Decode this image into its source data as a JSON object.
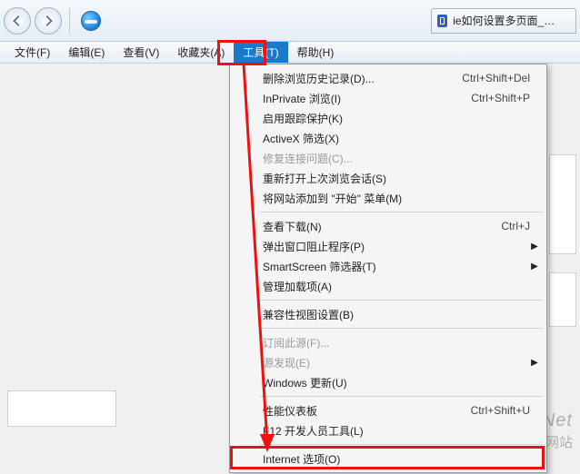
{
  "titlebar": {
    "tab_title": "ie如何设置多页面_百度搜..."
  },
  "menubar": {
    "items": [
      {
        "label": "文件(F)"
      },
      {
        "label": "编辑(E)"
      },
      {
        "label": "查看(V)"
      },
      {
        "label": "收藏夹(A)"
      },
      {
        "label": "工具(T)",
        "active": true
      },
      {
        "label": "帮助(H)"
      }
    ]
  },
  "dropdown": {
    "groups": [
      [
        {
          "label": "删除浏览历史记录(D)...",
          "shortcut": "Ctrl+Shift+Del"
        },
        {
          "label": "InPrivate 浏览(I)",
          "shortcut": "Ctrl+Shift+P"
        },
        {
          "label": "启用跟踪保护(K)"
        },
        {
          "label": "ActiveX 筛选(X)"
        },
        {
          "label": "修复连接问题(C)...",
          "disabled": true
        },
        {
          "label": "重新打开上次浏览会话(S)"
        },
        {
          "label": "将网站添加到 \"开始\" 菜单(M)"
        }
      ],
      [
        {
          "label": "查看下载(N)",
          "shortcut": "Ctrl+J"
        },
        {
          "label": "弹出窗口阻止程序(P)",
          "submenu": true
        },
        {
          "label": "SmartScreen 筛选器(T)",
          "submenu": true
        },
        {
          "label": "管理加载项(A)"
        }
      ],
      [
        {
          "label": "兼容性视图设置(B)"
        }
      ],
      [
        {
          "label": "订阅此源(F)...",
          "disabled": true
        },
        {
          "label": "源发现(E)",
          "disabled": true,
          "submenu": true
        },
        {
          "label": "Windows 更新(U)"
        }
      ],
      [
        {
          "label": "性能仪表板",
          "shortcut": "Ctrl+Shift+U"
        },
        {
          "label": "F12 开发人员工具(L)"
        }
      ],
      [
        {
          "label": "Internet 选项(O)",
          "highlight": true
        }
      ]
    ]
  },
  "watermark": {
    "line1": "ieFans.Net",
    "line2": "IE浏览器中文网站"
  }
}
